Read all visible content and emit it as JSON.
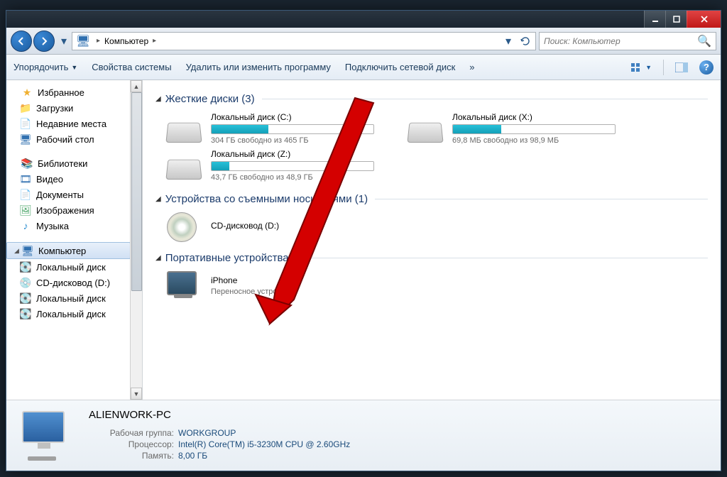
{
  "address": {
    "location": "Компьютер",
    "search_placeholder": "Поиск: Компьютер"
  },
  "toolbar": {
    "organize": "Упорядочить",
    "sysprops": "Свойства системы",
    "uninstall": "Удалить или изменить программу",
    "mapdrive": "Подключить сетевой диск",
    "more": "»"
  },
  "sidebar": {
    "favorites": {
      "label": "Избранное",
      "items": [
        "Загрузки",
        "Недавние места",
        "Рабочий стол"
      ]
    },
    "libraries": {
      "label": "Библиотеки",
      "items": [
        "Видео",
        "Документы",
        "Изображения",
        "Музыка"
      ]
    },
    "computer": {
      "label": "Компьютер",
      "items": [
        "Локальный диск",
        "CD-дисковод (D:)",
        "Локальный диск",
        "Локальный диск"
      ]
    }
  },
  "content": {
    "hdd": {
      "title": "Жесткие диски (3)",
      "drives": [
        {
          "name": "Локальный диск (C:)",
          "free": "304 ГБ свободно из 465 ГБ",
          "fill": 35
        },
        {
          "name": "Локальный диск (X:)",
          "free": "69,8 МБ свободно из 98,9 МБ",
          "fill": 30
        },
        {
          "name": "Локальный диск (Z:)",
          "free": "43,7 ГБ свободно из 48,9 ГБ",
          "fill": 11
        }
      ]
    },
    "removable": {
      "title": "Устройства со съемными носителями (1)",
      "items": [
        {
          "name": "CD-дисковод (D:)"
        }
      ]
    },
    "portable": {
      "title": "Портативные устройства (1)",
      "items": [
        {
          "name": "iPhone",
          "sub": "Переносное устройство"
        }
      ]
    }
  },
  "details": {
    "name": "ALIENWORK-PC",
    "rows": [
      {
        "label": "Рабочая группа:",
        "value": "WORKGROUP"
      },
      {
        "label": "Процессор:",
        "value": "Intel(R) Core(TM) i5-3230M CPU @ 2.60GHz"
      },
      {
        "label": "Память:",
        "value": "8,00 ГБ"
      }
    ]
  }
}
